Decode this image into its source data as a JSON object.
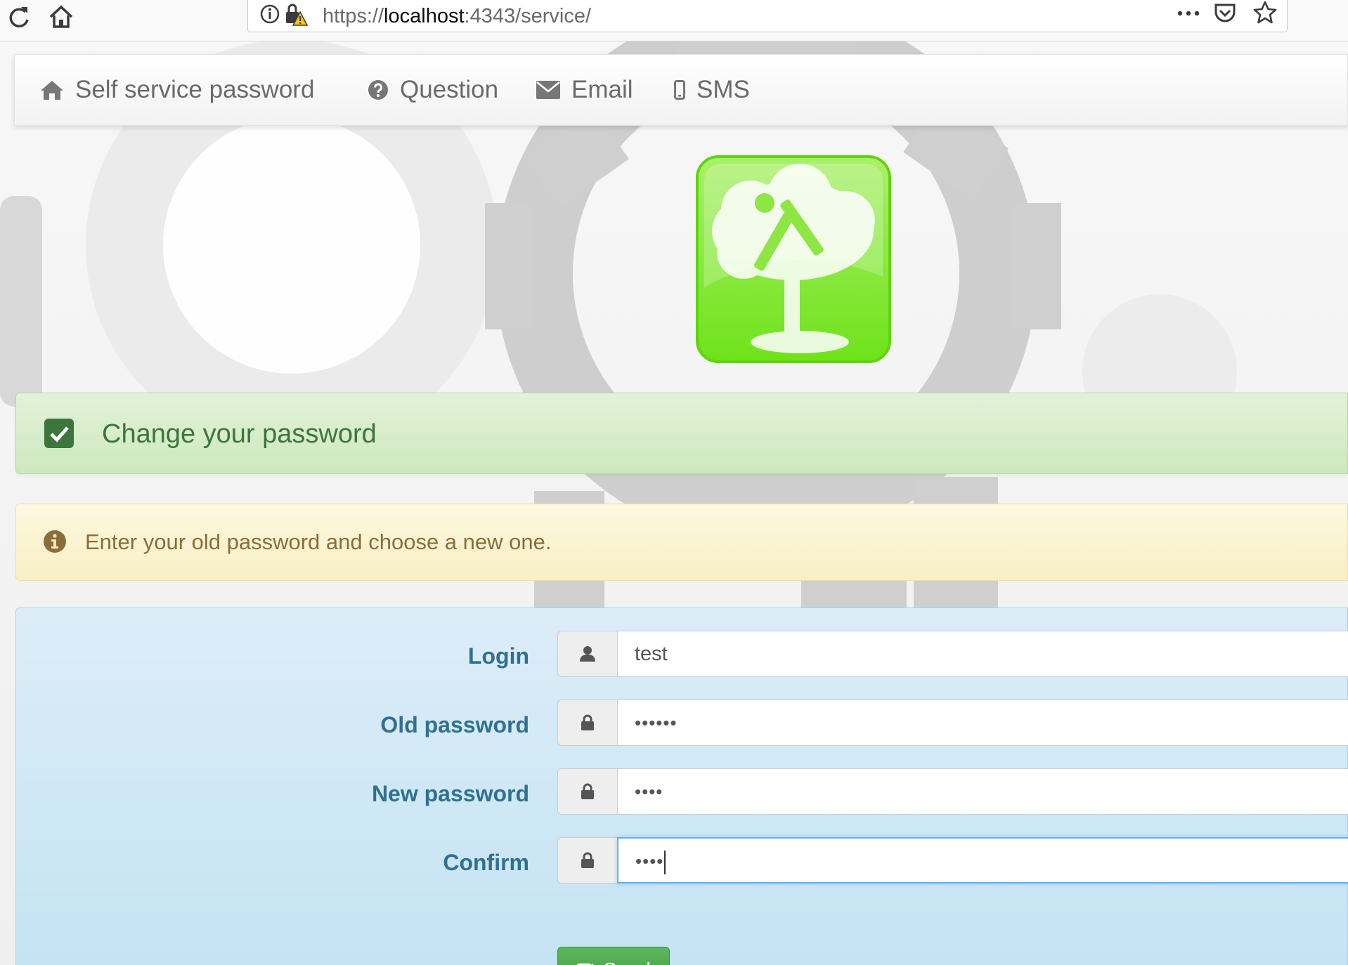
{
  "browser": {
    "url_prefix": "https://",
    "url_host": "localhost",
    "url_path": ":4343/service/",
    "icons": [
      "reload-icon",
      "home-icon",
      "info-icon",
      "insecure-lock-icon",
      "more-icon",
      "pocket-icon",
      "bookmark-star-icon"
    ]
  },
  "navbar": {
    "brand": "Self service password",
    "items": [
      {
        "label": "Question",
        "icon": "question-circle-icon"
      },
      {
        "label": "Email",
        "icon": "envelope-icon"
      },
      {
        "label": "SMS",
        "icon": "mobile-phone-icon"
      }
    ]
  },
  "alerts": {
    "success": "Change your password",
    "info": "Enter your old password and choose a new one."
  },
  "form": {
    "login_label": "Login",
    "login_value": "test",
    "old_password_label": "Old password",
    "old_password_value": "••••••",
    "new_password_label": "New password",
    "new_password_value": "••••",
    "confirm_label": "Confirm",
    "confirm_value": "••••",
    "send_label": "Send"
  },
  "colors": {
    "success_text": "#3c763d",
    "warning_text": "#8a6d3b",
    "info_label": "#31708f",
    "send_button": "#4cae4c",
    "logo_green": "#7be23c"
  }
}
